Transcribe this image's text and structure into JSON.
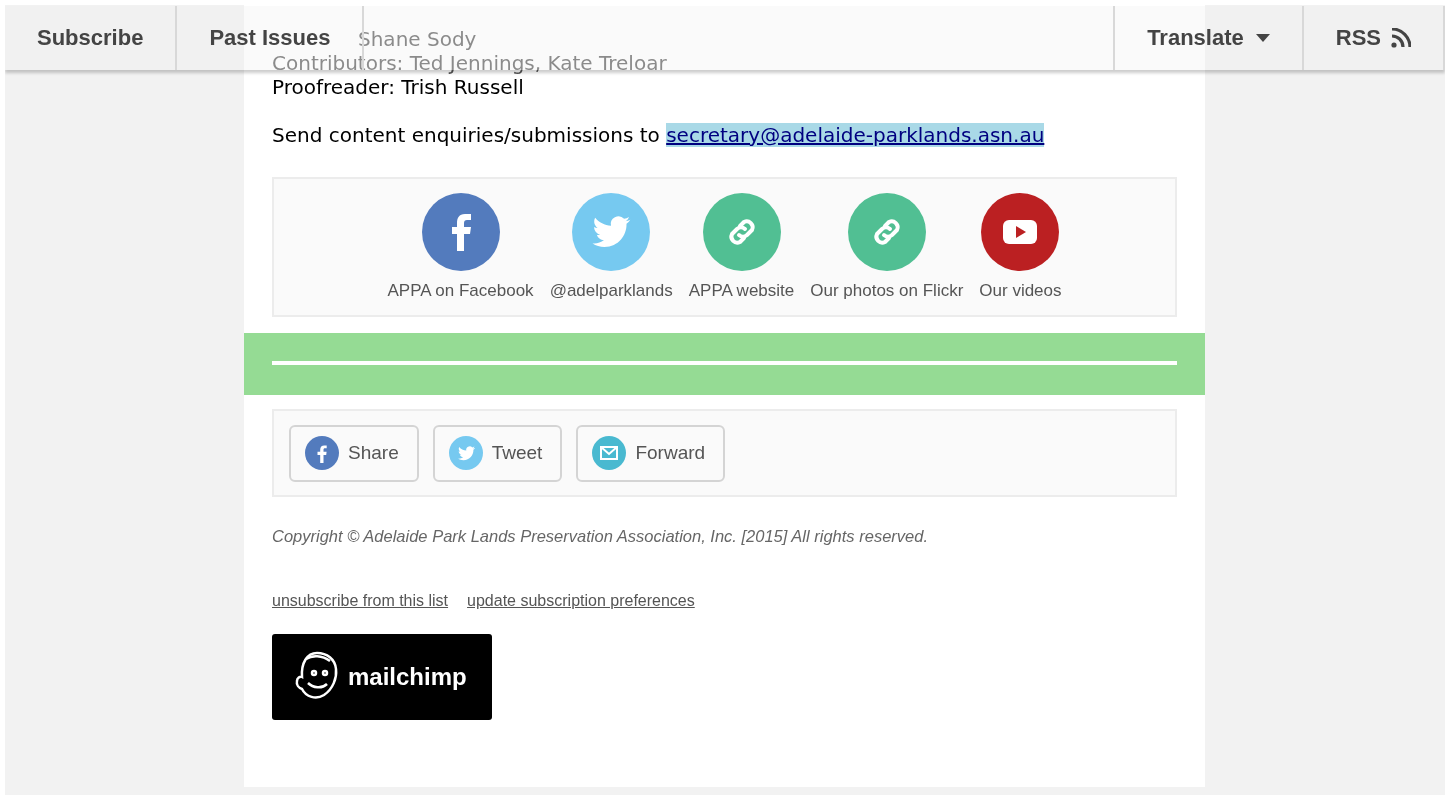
{
  "nav": {
    "left": [
      {
        "label": "Subscribe"
      },
      {
        "label": "Past Issues"
      }
    ],
    "right": [
      {
        "label": "Translate",
        "kind": "dropdown"
      },
      {
        "label": "RSS",
        "kind": "feed"
      }
    ]
  },
  "credits": [
    "Shane Sody",
    "Contributors: Ted Jennings, Kate Treloar",
    "Proofreader: Trish Russell"
  ],
  "contact": {
    "text": "Send content enquiries/submissions to",
    "email": "secretary@adelaide-parklands.asn.au"
  },
  "social_links": [
    {
      "label": "APPA on Facebook",
      "kind": "facebook",
      "color": "#537bbd"
    },
    {
      "label": "@adelparklands",
      "kind": "twitter",
      "color": "#76c9f0"
    },
    {
      "label": "APPA website",
      "kind": "link",
      "color": "#51bf93"
    },
    {
      "label": "Our photos on Flickr",
      "kind": "link",
      "color": "#51bf93"
    },
    {
      "label": "Our videos",
      "kind": "youtube",
      "color": "#bb2022"
    }
  ],
  "share_buttons": [
    {
      "label": "Share",
      "kind": "facebook",
      "color": "#537bbd"
    },
    {
      "label": "Tweet",
      "kind": "twitter",
      "color": "#76c9f0"
    },
    {
      "label": "Forward",
      "kind": "email",
      "color": "#49b9d0"
    }
  ],
  "copyright": "Copyright © Adelaide Park Lands Preservation Association, Inc. [2015] All rights reserved.",
  "footer_links": [
    "unsubscribe from this list",
    "update subscription preferences"
  ],
  "badge": {
    "label": "mailchimp"
  }
}
